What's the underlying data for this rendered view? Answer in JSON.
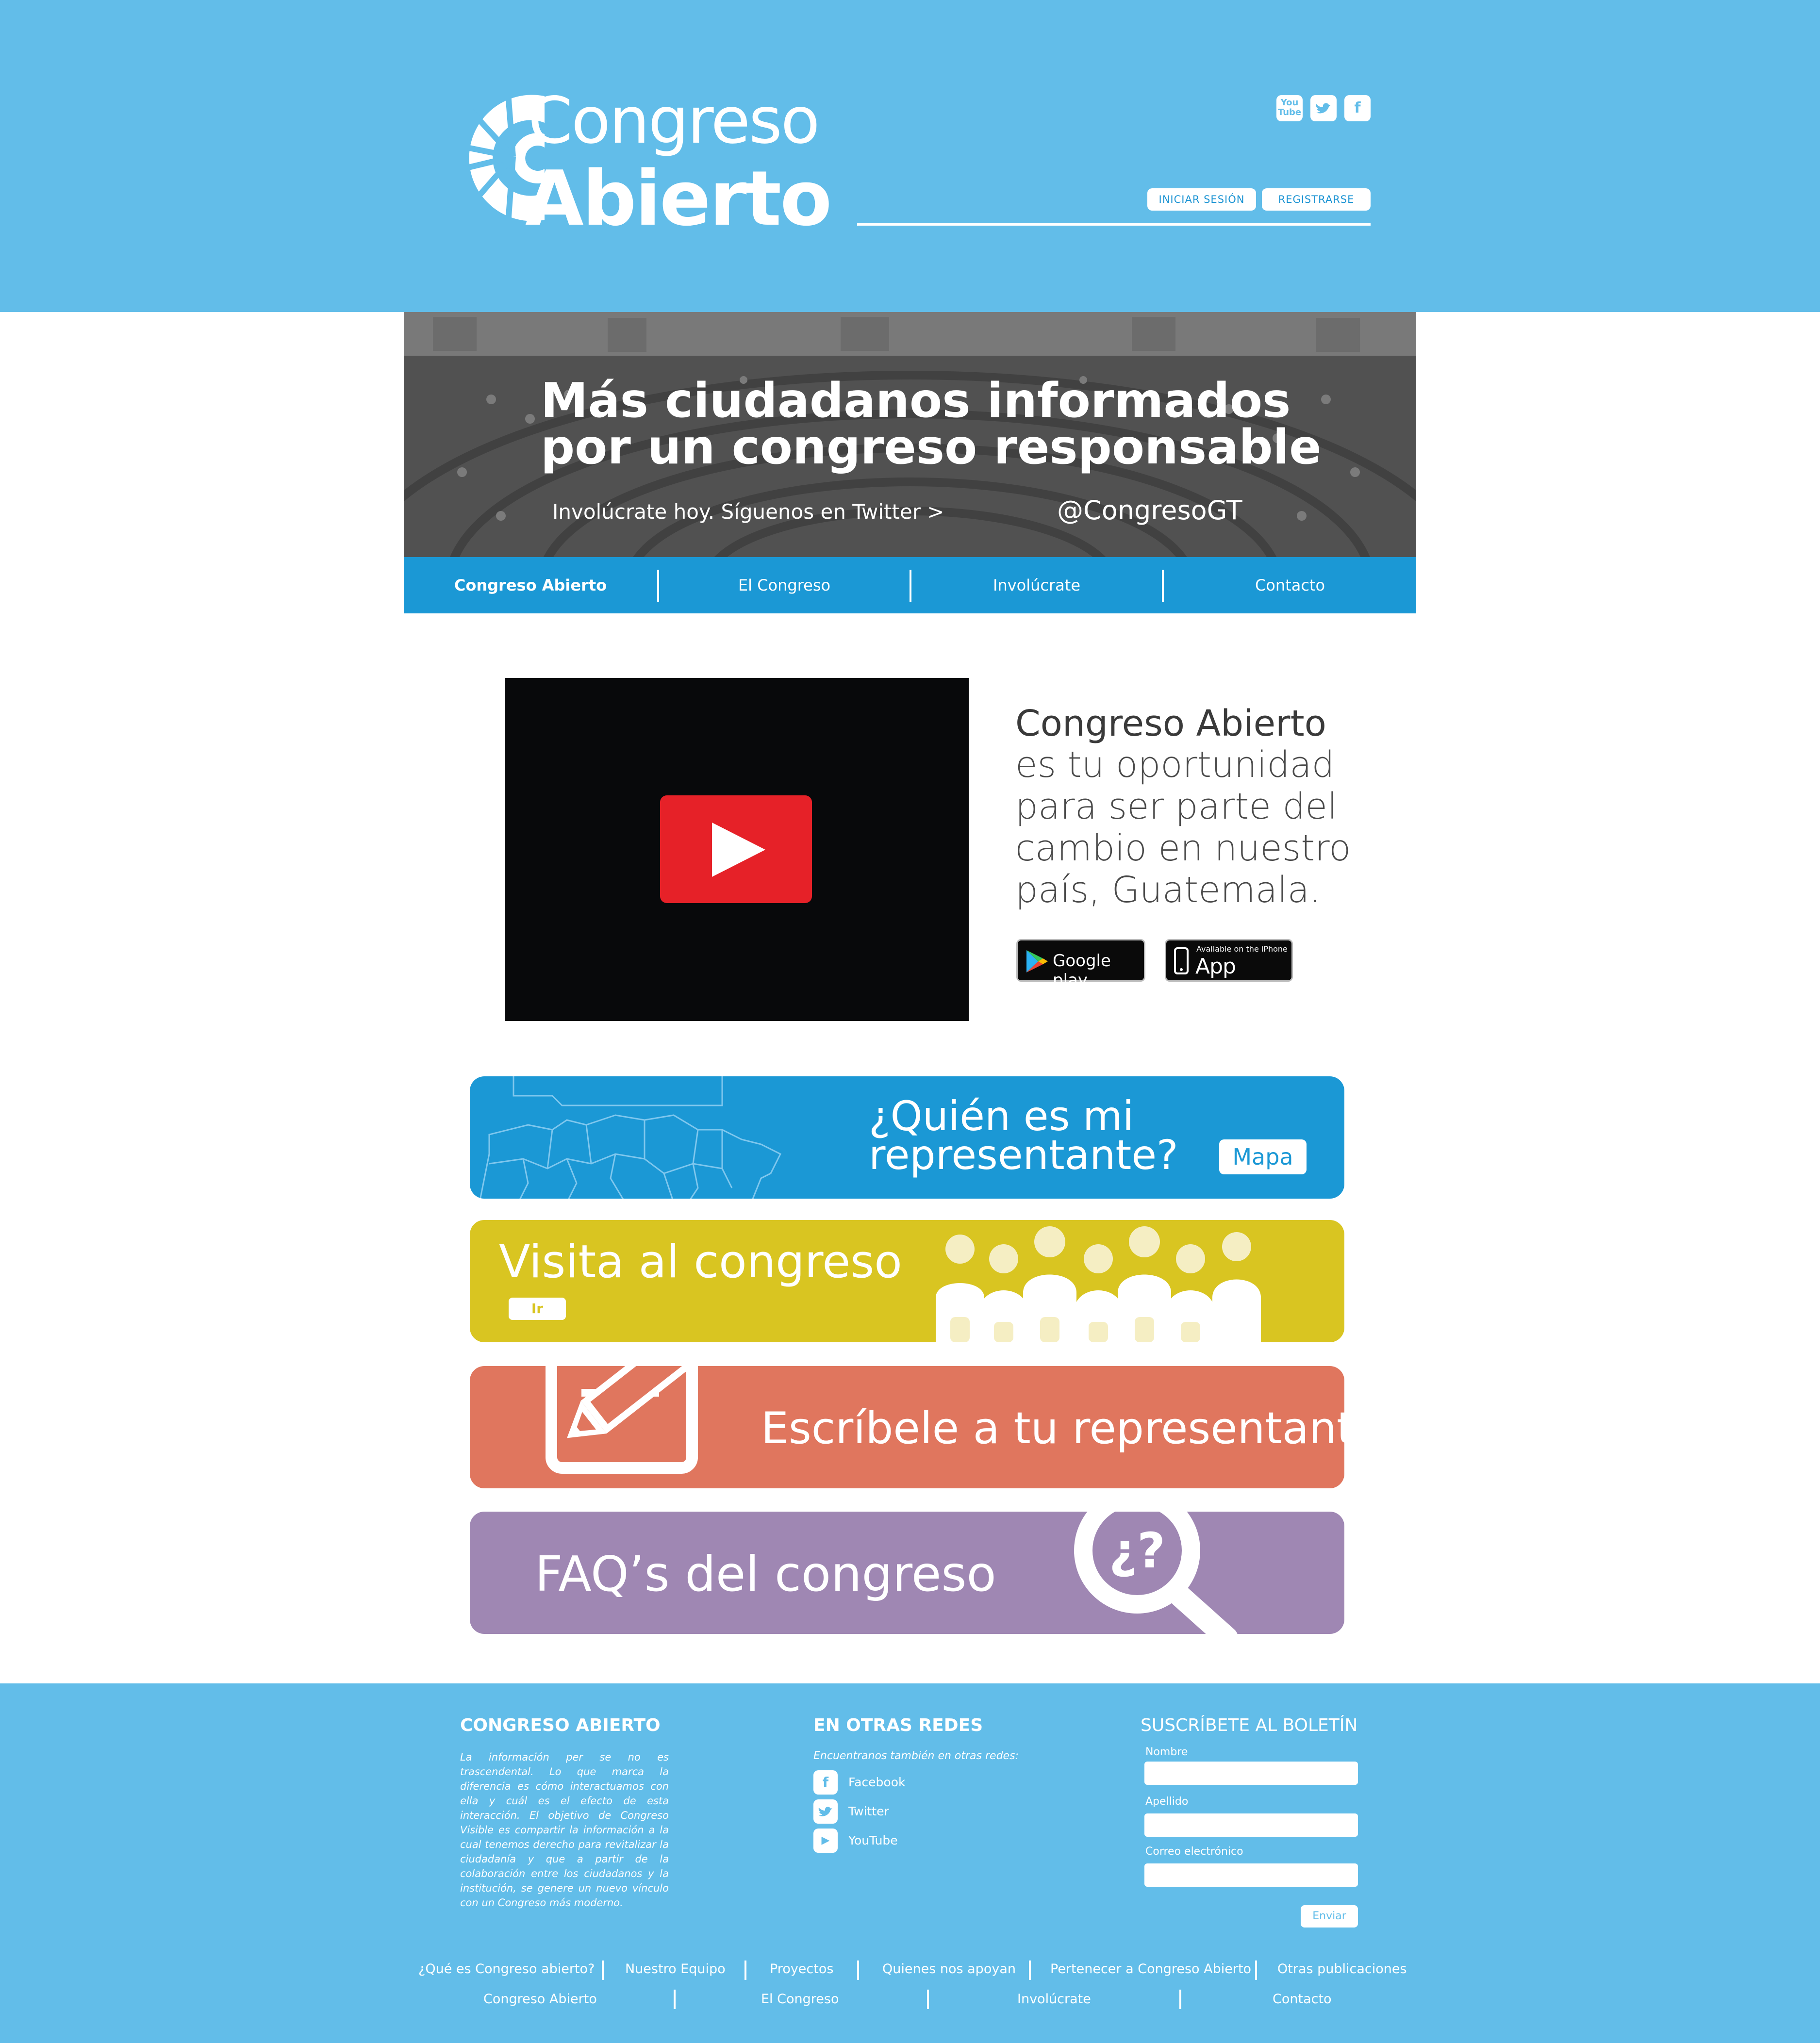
{
  "header": {
    "logo_line1": "Congreso",
    "logo_line2": "Abierto",
    "social": [
      "youtube-icon",
      "twitter-icon",
      "facebook-icon"
    ],
    "login_label": "INICIAR SESIÓN",
    "register_label": "REGISTRARSE"
  },
  "hero": {
    "title_line1": "Más ciudadanos informados",
    "title_line2": "por un congreso responsable",
    "subtitle": "Involúcrate hoy. Síguenos en Twitter  >",
    "handle": "@CongresoGT"
  },
  "nav": {
    "items": [
      "Congreso Abierto",
      "El Congreso",
      "Involúcrate",
      "Contacto"
    ]
  },
  "intro": {
    "heading": "Congreso Abierto",
    "body_lines": [
      "es tu oportunidad",
      "para ser parte del",
      "cambio en nuestro",
      "país, Guatemala."
    ],
    "google_play_label": "Google play",
    "app_store_small": "Available on the iPhone",
    "app_store_label": "App Store"
  },
  "cards": {
    "representative": {
      "title_line1": "¿Quién es mi",
      "title_line2": "representante?",
      "button": "Mapa"
    },
    "visit": {
      "title": "Visita al congreso",
      "button": "Ir"
    },
    "write": {
      "title": "Escríbele a tu representante"
    },
    "faq": {
      "title": "FAQ’s del congreso",
      "icon_text": "¿?"
    }
  },
  "footer": {
    "about_title": "CONGRESO ABIERTO",
    "about_text": "La información per se no es trascendental. Lo que marca la diferencia es cómo interactuamos con ella y cuál es el efecto de esta interacción. El objetivo de Congreso Visible es compartir la información a la cual tenemos derecho para revitalizar la ciudadanía y que a partir de la colaboración entre los ciudadanos y la institución, se genere un nuevo vínculo con un Congreso más moderno.",
    "networks_title": "EN OTRAS REDES",
    "networks_text": "Encuentranos también en otras redes:",
    "networks": [
      {
        "icon": "facebook-icon",
        "glyph": "f",
        "label": "Facebook"
      },
      {
        "icon": "twitter-icon",
        "glyph": "t",
        "label": "Twitter"
      },
      {
        "icon": "youtube-icon",
        "glyph": "▶",
        "label": "YouTube"
      }
    ],
    "newsletter_title": "SUSCRÍBETE AL BOLETÍN",
    "field_name": "Nombre",
    "field_lastname": "Apellido",
    "field_email": "Correo electrónico",
    "send_label": "Enviar",
    "links_row1": [
      "¿Qué es Congreso abierto?",
      "Nuestro Equipo",
      "Proyectos",
      "Quienes nos apoyan",
      "Pertenecer a Congreso Abierto",
      "Otras publicaciones"
    ],
    "links_row2": [
      "Congreso Abierto",
      "El Congreso",
      "Involúcrate",
      "Contacto"
    ]
  },
  "colors": {
    "header_bg": "#62bde9",
    "nav_bg": "#1b98d5",
    "card_rep": "#1b98d5",
    "card_visit": "#d9c521",
    "card_write": "#e0765e",
    "card_faq": "#9f87b3",
    "play_red": "#e62128"
  }
}
